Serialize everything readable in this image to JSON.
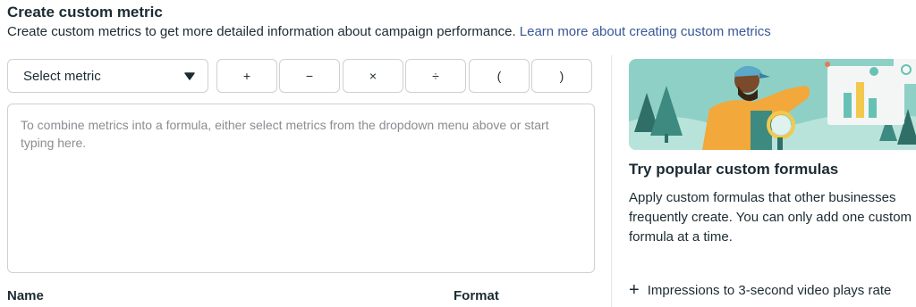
{
  "header": {
    "title": "Create custom metric",
    "subtitle": "Create custom metrics to get more detailed information about campaign performance.",
    "learn_more": "Learn more about creating custom metrics"
  },
  "metric_select": {
    "label": "Select metric",
    "icon": "caret-down-icon"
  },
  "operators": [
    "+",
    "−",
    "×",
    "÷",
    "(",
    ")"
  ],
  "formula": {
    "placeholder": "To combine metrics into a formula, either select metrics from the dropdown menu above or start typing here."
  },
  "columns": {
    "name": "Name",
    "format": "Format"
  },
  "side_panel": {
    "title": "Try popular custom formulas",
    "description": "Apply custom formulas that other businesses frequently create. You can only add one custom formula at a time.",
    "suggestions": [
      {
        "label": "Impressions to 3-second video plays rate"
      }
    ]
  },
  "colors": {
    "link": "#385898",
    "border": "#ced0d4",
    "illustration_bg": "#8fd0c6",
    "figure_orange": "#f2a83b"
  }
}
